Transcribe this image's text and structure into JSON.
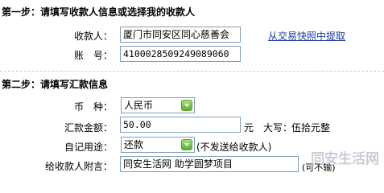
{
  "step1": {
    "title": "第一步：请填写收款人信息或选择我的收款人",
    "payee_label": "收款人：",
    "payee_value": "厦门市同安区同心慈善会",
    "account_label": "账　号：",
    "account_value": "4100028509249089060",
    "snapshot_link": "从交易快照中提取"
  },
  "step2": {
    "title": "第二步：请填写汇款信息",
    "currency_label": "币　种：",
    "currency_value": "人民币",
    "amount_label": "汇款金额：",
    "amount_value": "50.00",
    "amount_unit": "元",
    "capital_label": "大写：",
    "capital_value": "伍拾元整",
    "purpose_label": "自记用途：",
    "purpose_value": "还款",
    "purpose_note": "(不发送给收款人)",
    "message_label": "给收款人附言：",
    "message_value": "同安生活网 助学圆梦项目",
    "message_note": "(可不输)"
  },
  "watermark": {
    "text": "同安生活网",
    "color": "#c7cdd6"
  },
  "colors": {
    "link": "#1a3aa6",
    "border": "#7f9db9",
    "select_button": "#5ab12a"
  }
}
